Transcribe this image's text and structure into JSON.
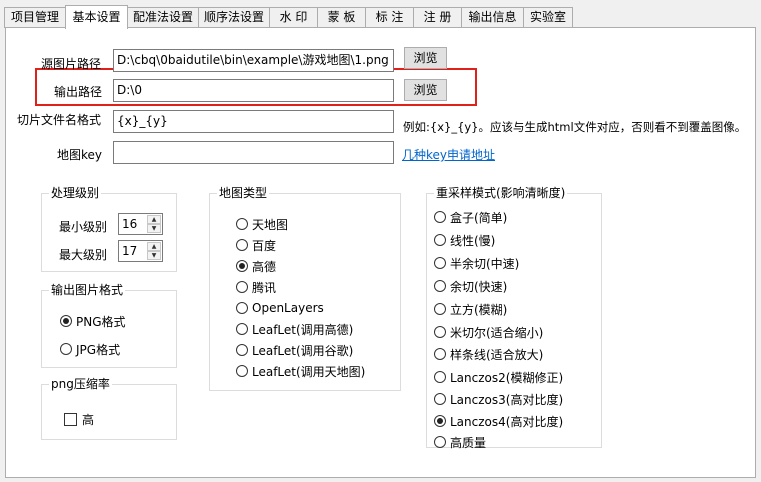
{
  "tabs": [
    {
      "label": "项目管理"
    },
    {
      "label": "基本设置"
    },
    {
      "label": "配准法设置"
    },
    {
      "label": "顺序法设置"
    },
    {
      "label": "水 印"
    },
    {
      "label": "蒙 板"
    },
    {
      "label": "标 注"
    },
    {
      "label": "注 册"
    },
    {
      "label": "输出信息"
    },
    {
      "label": "实验室"
    }
  ],
  "fields": {
    "source_label": "源图片路径",
    "source_value": "D:\\cbq\\0baidutile\\bin\\example\\游戏地图\\1.png",
    "output_label": "输出路径",
    "output_value": "D:\\0",
    "tile_name_label": "切片文件名格式",
    "tile_name_value": "{x}_{y}",
    "tile_name_hint": "例如:{x}_{y}。应该与生成html文件对应，否则看不到覆盖图像。",
    "map_key_label": "地图key",
    "map_key_value": "",
    "map_key_link": "几种key申请地址",
    "browse_label": "浏览"
  },
  "levels": {
    "title": "处理级别",
    "min_label": "最小级别",
    "min_value": "16",
    "max_label": "最大级别",
    "max_value": "17"
  },
  "format": {
    "title": "输出图片格式",
    "options": [
      {
        "label": "PNG格式",
        "selected": true
      },
      {
        "label": "JPG格式",
        "selected": false
      }
    ]
  },
  "png_compress": {
    "title": "png压缩率",
    "high_label": "高",
    "high_checked": false
  },
  "map_type": {
    "title": "地图类型",
    "options": [
      {
        "label": "天地图",
        "selected": false
      },
      {
        "label": "百度",
        "selected": false
      },
      {
        "label": "高德",
        "selected": true
      },
      {
        "label": "腾讯",
        "selected": false
      },
      {
        "label": "OpenLayers",
        "selected": false
      },
      {
        "label": "LeafLet(调用高德)",
        "selected": false
      },
      {
        "label": "LeafLet(调用谷歌)",
        "selected": false
      },
      {
        "label": "LeafLet(调用天地图)",
        "selected": false
      }
    ]
  },
  "resample": {
    "title": "重采样模式(影响清晰度)",
    "options": [
      {
        "label": "盒子(简单)",
        "selected": false
      },
      {
        "label": "线性(慢)",
        "selected": false
      },
      {
        "label": "半余切(中速)",
        "selected": false
      },
      {
        "label": "余切(快速)",
        "selected": false
      },
      {
        "label": "立方(模糊)",
        "selected": false
      },
      {
        "label": "米切尔(适合缩小)",
        "selected": false
      },
      {
        "label": "样条线(适合放大)",
        "selected": false
      },
      {
        "label": "Lanczos2(模糊修正)",
        "selected": false
      },
      {
        "label": "Lanczos3(高对比度)",
        "selected": false
      },
      {
        "label": "Lanczos4(高对比度)",
        "selected": true
      },
      {
        "label": "高质量",
        "selected": false
      }
    ]
  },
  "colors": {
    "highlight": "#e0201a",
    "link": "#0066cc"
  }
}
